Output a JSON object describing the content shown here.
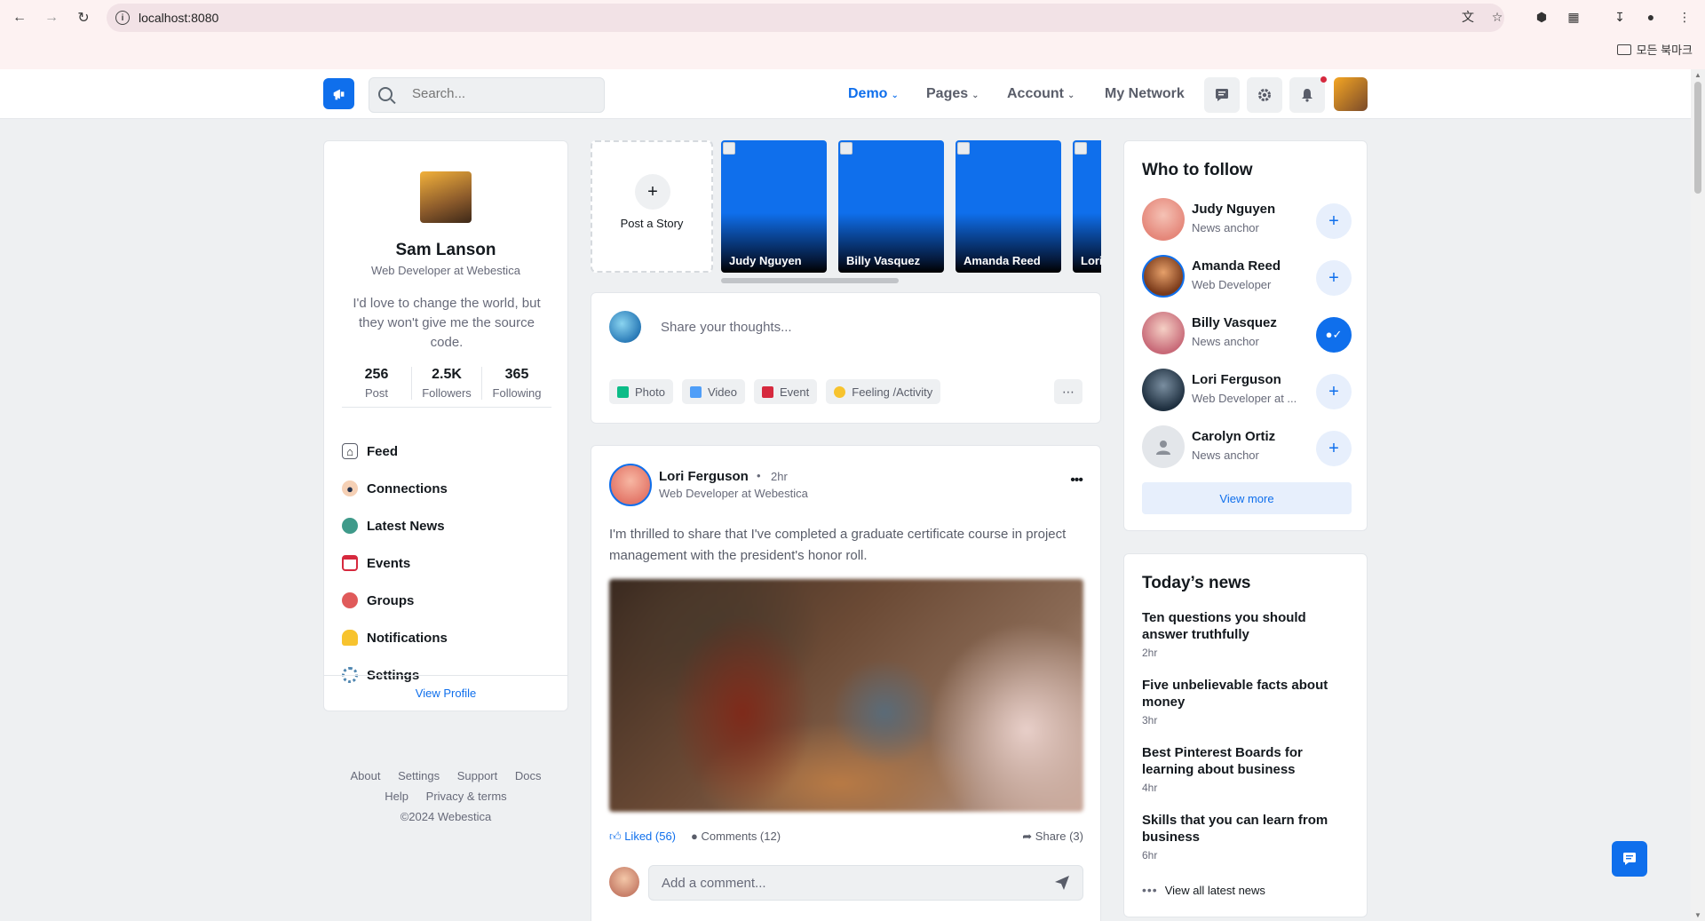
{
  "browser": {
    "url": "localhost:8080",
    "bookmarks_label": "모든 북마크"
  },
  "navbar": {
    "search_placeholder": "Search...",
    "menu": [
      {
        "label": "Demo"
      },
      {
        "label": "Pages"
      },
      {
        "label": "Account"
      },
      {
        "label": "My Network"
      }
    ],
    "icons": [
      "chat-icon",
      "gear-icon",
      "bell-icon"
    ]
  },
  "profile": {
    "name": "Sam Lanson",
    "role": "Web Developer at Webestica",
    "bio": "I'd love to change the world, but they won't give me the source code.",
    "stats": [
      {
        "value": "256",
        "label": "Post"
      },
      {
        "value": "2.5K",
        "label": "Followers"
      },
      {
        "value": "365",
        "label": "Following"
      }
    ],
    "menu": [
      {
        "label": "Feed",
        "icon": "home-icon"
      },
      {
        "label": "Connections",
        "icon": "person-icon"
      },
      {
        "label": "Latest News",
        "icon": "globe-icon"
      },
      {
        "label": "Events",
        "icon": "calendar-icon"
      },
      {
        "label": "Groups",
        "icon": "chat-bubbles-icon"
      },
      {
        "label": "Notifications",
        "icon": "bell-icon"
      },
      {
        "label": "Settings",
        "icon": "gear-icon"
      }
    ],
    "view_profile": "View Profile"
  },
  "footer": {
    "links_row1": [
      "About",
      "Settings",
      "Support",
      "Docs"
    ],
    "links_row2": [
      "Help",
      "Privacy & terms"
    ],
    "copyright": "©2024 Webestica"
  },
  "stories": {
    "add_label": "Post a Story",
    "items": [
      {
        "name": "Judy Nguyen"
      },
      {
        "name": "Billy Vasquez"
      },
      {
        "name": "Amanda Reed"
      },
      {
        "name": "Lori Ferguson"
      }
    ]
  },
  "composer": {
    "placeholder": "Share your thoughts...",
    "actions": [
      {
        "label": "Photo",
        "color": "#0cbc87"
      },
      {
        "label": "Video",
        "color": "#4f9ef8"
      },
      {
        "label": "Event",
        "color": "#d6293e"
      },
      {
        "label": "Feeling /Activity",
        "color": "#f7c32e"
      }
    ]
  },
  "post": {
    "author": "Lori Ferguson",
    "time": "2hr",
    "role": "Web Developer at Webestica",
    "text": "I'm thrilled to share that I've completed a graduate certificate course in project management with the president's honor roll.",
    "liked": "Liked (56)",
    "comments": "Comments (12)",
    "share": "Share (3)",
    "comment_placeholder": "Add a comment..."
  },
  "who_to_follow": {
    "title": "Who to follow",
    "people": [
      {
        "name": "Judy Nguyen",
        "role": "News anchor",
        "following": false
      },
      {
        "name": "Amanda Reed",
        "role": "Web Developer",
        "following": false
      },
      {
        "name": "Billy Vasquez",
        "role": "News anchor",
        "following": true
      },
      {
        "name": "Lori Ferguson",
        "role": "Web Developer at ...",
        "following": false
      },
      {
        "name": "Carolyn Ortiz",
        "role": "News anchor",
        "following": false
      }
    ],
    "view_more": "View more"
  },
  "news": {
    "title": "Today’s news",
    "items": [
      {
        "title": "Ten questions you should answer truthfully",
        "time": "2hr"
      },
      {
        "title": "Five unbelievable facts about money",
        "time": "3hr"
      },
      {
        "title": "Best Pinterest Boards for learning about business",
        "time": "4hr"
      },
      {
        "title": "Skills that you can learn from business",
        "time": "6hr"
      }
    ],
    "view_all": "View all latest news"
  },
  "colors": {
    "primary": "#0f6fec",
    "background": "#eef0f2",
    "danger": "#d6293e"
  }
}
